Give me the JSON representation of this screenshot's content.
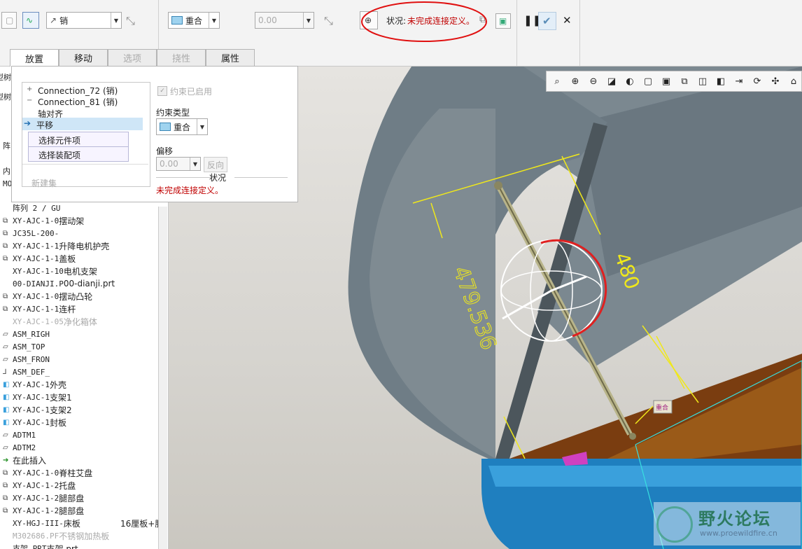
{
  "toolbar": {
    "flip_dropdown": "销",
    "constraint_dropdown": "重合",
    "offset_value": "0.00",
    "status_label": "状况:",
    "status_value": "未完成连接定义。",
    "pause_icon": "pause-icon",
    "ok_icon": "check-icon",
    "cancel_icon": "close-icon"
  },
  "tabs": [
    {
      "label": "放置",
      "state": "active"
    },
    {
      "label": "移动",
      "state": "normal"
    },
    {
      "label": "选项",
      "state": "disabled"
    },
    {
      "label": "挠性",
      "state": "disabled"
    },
    {
      "label": "属性",
      "state": "normal"
    }
  ],
  "panel": {
    "connections": [
      {
        "label": "Connection_72 (销)",
        "expander": "+"
      },
      {
        "label": "Connection_81 (销)",
        "expander": "−"
      }
    ],
    "sets": [
      {
        "label": "轴对齐",
        "selected": false
      },
      {
        "label": "平移",
        "selected": true
      }
    ],
    "collectors": [
      "选择元件项",
      "选择装配项"
    ],
    "new_set": "新建集",
    "constraint_enabled": "约束已启用",
    "constraint_type_label": "约束类型",
    "constraint_type_value": "重合",
    "offset_label": "偏移",
    "offset_value": "0.00",
    "flip_button": "反向",
    "status_label": "状况",
    "status_value": "未完成连接定义。"
  },
  "tree": {
    "partial_rows": [
      "型树",
      "型树",
      "阵",
      "内",
      "MO"
    ],
    "items": [
      {
        "icon": "",
        "text": "阵列 2 / GU",
        "grey": false
      },
      {
        "icon": "part-icon",
        "text": "XY-AJC-1-0",
        "cn": "摆动架",
        "grey": false
      },
      {
        "icon": "part-icon",
        "text": "JC35L-200-",
        "cn": "",
        "grey": false
      },
      {
        "icon": "part-icon",
        "text": "XY-AJC-1-1",
        "cn": "升降电机护壳",
        "grey": false
      },
      {
        "icon": "part-icon",
        "text": "XY-AJC-1-1",
        "cn": "盖板",
        "grey": false
      },
      {
        "icon": "",
        "text": "XY-AJC-1-10",
        "cn": "电机支架",
        "grey": false
      },
      {
        "icon": "",
        "text": "00-DIANJI.P",
        "cn": "00-dianji.prt",
        "grey": false
      },
      {
        "icon": "part-icon",
        "text": "XY-AJC-1-0",
        "cn": "摆动凸轮",
        "grey": false
      },
      {
        "icon": "part-icon",
        "text": "XY-AJC-1-1",
        "cn": "连杆",
        "grey": false
      },
      {
        "icon": "",
        "text": "XY-AJC-1-05",
        "cn": "净化箱体",
        "grey": true
      },
      {
        "icon": "plane-icon",
        "text": "ASM_RIGH",
        "cn": "",
        "grey": false
      },
      {
        "icon": "plane-icon",
        "text": "ASM_TOP",
        "cn": "",
        "grey": false
      },
      {
        "icon": "plane-icon",
        "text": "ASM_FRON",
        "cn": "",
        "grey": false
      },
      {
        "icon": "csys-icon",
        "text": "ASM_DEF_",
        "cn": "",
        "grey": false
      },
      {
        "icon": "surface-icon",
        "text": "XY-AJC-1",
        "cn": "外壳",
        "grey": false
      },
      {
        "icon": "surface-icon",
        "text": "XY-AJC-1",
        "cn": "支架1",
        "grey": false
      },
      {
        "icon": "surface-icon",
        "text": "XY-AJC-1",
        "cn": "支架2",
        "grey": false
      },
      {
        "icon": "surface-icon",
        "text": "XY-AJC-1",
        "cn": "封板",
        "grey": false
      },
      {
        "icon": "plane-icon",
        "text": "ADTM1",
        "cn": "",
        "grey": false
      },
      {
        "icon": "plane-icon",
        "text": "ADTM2",
        "cn": "",
        "grey": false
      },
      {
        "icon": "insert-arrow-icon",
        "text": "",
        "cn": "在此插入",
        "grey": false
      },
      {
        "icon": "part-icon",
        "text": "XY-AJC-1-0",
        "cn": "脊柱艾盘",
        "grey": false
      },
      {
        "icon": "part-icon",
        "text": "XY-AJC-1-2",
        "cn": "托盘",
        "grey": false
      },
      {
        "icon": "part-icon",
        "text": "XY-AJC-1-2",
        "cn": "腿部盘",
        "grey": false
      },
      {
        "icon": "part-icon",
        "text": "XY-AJC-1-2",
        "cn": "腿部盘",
        "grey": false
      },
      {
        "icon": "",
        "text": "XY-HGJ-III-",
        "cn": "床板",
        "extra": "16厘板+胳",
        "grey": false
      },
      {
        "icon": "",
        "text": "M302686.PF",
        "cn": "不锈钢加热板",
        "grey": true
      },
      {
        "icon": "",
        "text": "支架.PRT",
        "cn": "支架.prt",
        "grey": false
      }
    ]
  },
  "viewport": {
    "dim_1": "480",
    "dim_2": "479.536",
    "coincident_tag": "重合"
  },
  "watermark": {
    "title": "野火论坛",
    "url": "www.proewildfire.cn"
  },
  "colors": {
    "status_red": "#c00000",
    "dimension_yellow": "#f0e81a",
    "ring_red": "#e02020",
    "body_grey": "#6f7d86",
    "trim_blue": "#1f7fbf",
    "interior_brown": "#7a3d10"
  }
}
